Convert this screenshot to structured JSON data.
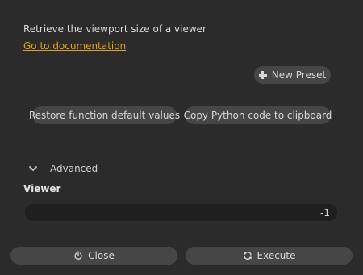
{
  "description": "Retrieve the viewport size of a viewer",
  "doc_link": "Go to documentation",
  "presets": {
    "new_preset_label": "New Preset"
  },
  "actions": {
    "restore_label": "Restore function default values",
    "copy_label": "Copy Python code to clipboard"
  },
  "advanced": {
    "label": "Advanced",
    "expanded": true
  },
  "viewer": {
    "label": "Viewer",
    "value": "-1"
  },
  "footer": {
    "close_label": "Close",
    "execute_label": "Execute"
  },
  "colors": {
    "background": "#2b2b2b",
    "button": "#464646",
    "field": "#1f1f1f",
    "link": "#e3a31c",
    "text": "#d8d8d8"
  },
  "icons": [
    "plus-icon",
    "chevron-down-icon",
    "power-icon",
    "refresh-icon"
  ]
}
